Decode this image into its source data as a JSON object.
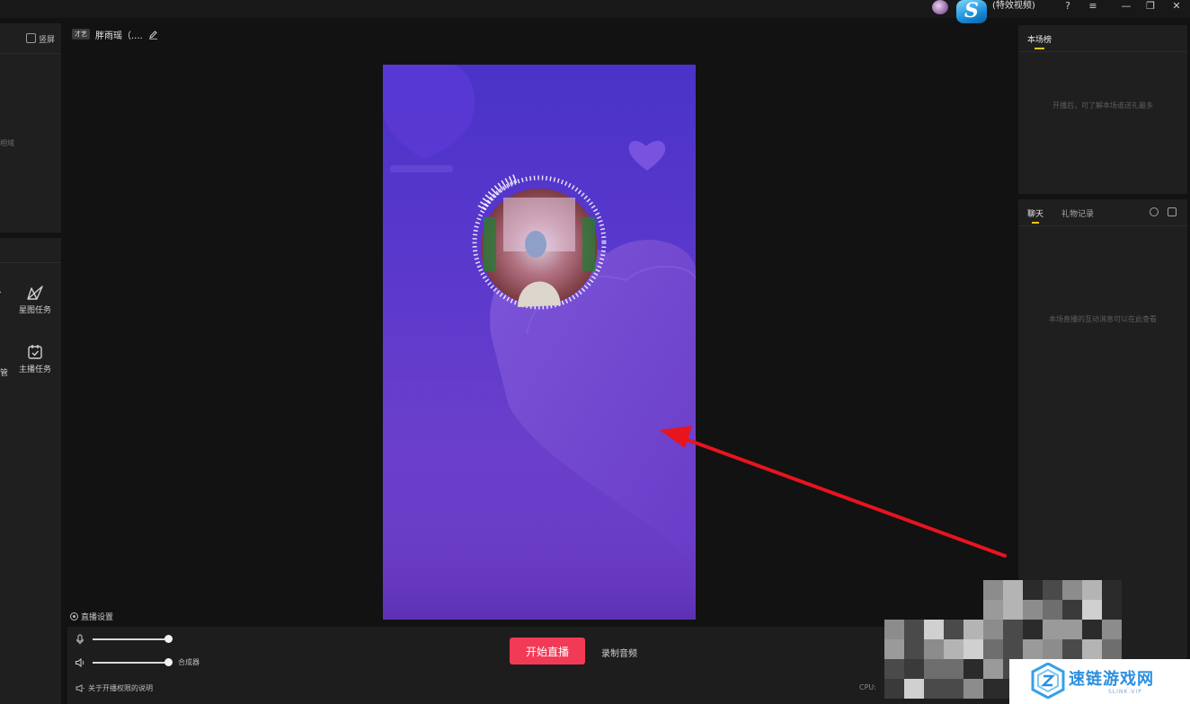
{
  "window": {
    "title": "(特效视频)",
    "logo_letter": "S",
    "controls": {
      "help": "?",
      "menu": "≡",
      "minimize": "—",
      "restore": "❐",
      "close": "✕"
    }
  },
  "left_panel": {
    "top_label": "竖屏",
    "cut_text": "相域",
    "tools": [
      {
        "label": "星图任务",
        "icon": "star-map-icon"
      },
      {
        "label": "主播任务",
        "icon": "task-calendar-icon"
      }
    ],
    "edge_cut_label": "管"
  },
  "stream": {
    "tag": "才艺",
    "name": "胖雨瑶（...."
  },
  "live_settings_label": "直播设置",
  "controls": {
    "mic_level": 1.0,
    "speaker_level": 1.0,
    "mixer_label": "合成器",
    "start_button": "开始直播",
    "record_audio": "录制音频",
    "permission_link": "关于开播权限的说明",
    "cpu_label": "CPU:"
  },
  "rank_panel": {
    "tab": "本场榜",
    "empty_text": "开播后，可了解本场谁送礼最多"
  },
  "chat_panel": {
    "tabs": [
      "聊天",
      "礼物记录"
    ],
    "empty_text": "本场直播的互动消息可以在此查看"
  },
  "watermark": {
    "brand": "速链游戏网",
    "sub": "SLINK.VIP"
  },
  "colors": {
    "accent_yellow": "#f5c518",
    "start_red": "#f23a57",
    "preview_purple": "#5a38cc",
    "arrow_red": "#e8141e"
  }
}
